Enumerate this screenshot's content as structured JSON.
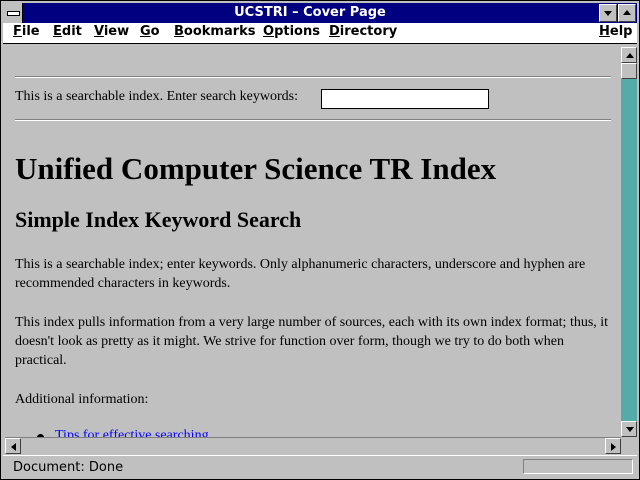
{
  "window": {
    "title": "UCSTRI – Cover Page"
  },
  "menu": {
    "file": "File",
    "edit": "Edit",
    "view": "View",
    "go": "Go",
    "bookmarks": "Bookmarks",
    "options": "Options",
    "directory": "Directory",
    "help": "Help"
  },
  "search": {
    "prompt": "This is a searchable index. Enter search keywords:",
    "value": ""
  },
  "page": {
    "heading": "Unified Computer Science TR Index",
    "subheading": "Simple Index Keyword Search",
    "paragraph1": "This is a searchable index; enter keywords. Only alphanumeric characters, underscore and hyphen are recommended characters in keywords.",
    "paragraph2": "This index pulls information from a very large number of sources, each with its own index format; thus, it doesn't look as pretty as it might. We strive for function over form, though we try to do both when practical.",
    "additional": "Additional information:",
    "links": [
      "Tips for effective searching"
    ]
  },
  "status": {
    "text": "Document: Done"
  },
  "icons": {
    "system_menu": "system-menu-icon",
    "minimize": "minimize-icon",
    "maximize": "maximize-icon",
    "scroll_up": "arrow-up-icon",
    "scroll_down": "arrow-down-icon",
    "scroll_left": "arrow-left-icon",
    "scroll_right": "arrow-right-icon"
  },
  "colors": {
    "titlebar": "#000080",
    "background": "#c0c0c0",
    "link": "#0000ff",
    "scrollbar_track": "#55aaaa"
  }
}
